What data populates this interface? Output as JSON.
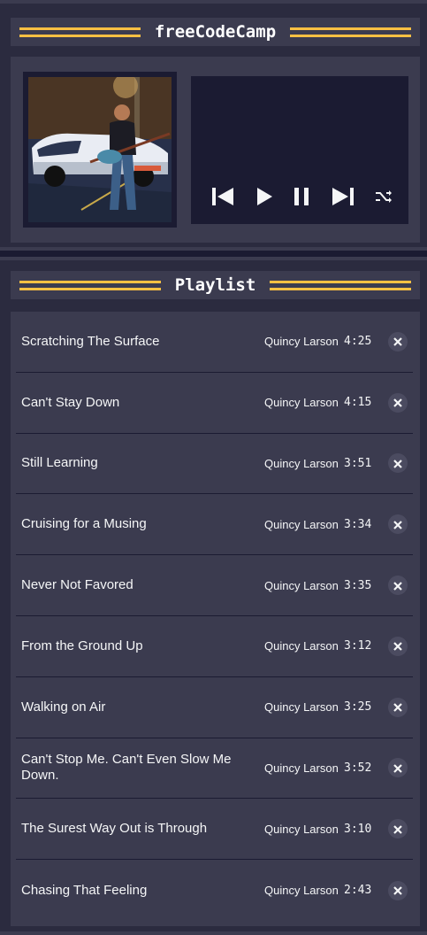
{
  "player": {
    "title": "freeCodeCamp",
    "controls": [
      {
        "name": "previous-button",
        "icon": "previous-icon"
      },
      {
        "name": "play-button",
        "icon": "play-icon"
      },
      {
        "name": "pause-button",
        "icon": "pause-icon"
      },
      {
        "name": "next-button",
        "icon": "next-icon"
      },
      {
        "name": "shuffle-button",
        "icon": "shuffle-icon"
      }
    ]
  },
  "playlist": {
    "title": "Playlist",
    "songs": [
      {
        "title": "Scratching The Surface",
        "artist": "Quincy Larson",
        "duration": "4:25"
      },
      {
        "title": "Can't Stay Down",
        "artist": "Quincy Larson",
        "duration": "4:15"
      },
      {
        "title": "Still Learning",
        "artist": "Quincy Larson",
        "duration": "3:51"
      },
      {
        "title": "Cruising for a Musing",
        "artist": "Quincy Larson",
        "duration": "3:34"
      },
      {
        "title": "Never Not Favored",
        "artist": "Quincy Larson",
        "duration": "3:35"
      },
      {
        "title": "From the Ground Up",
        "artist": "Quincy Larson",
        "duration": "3:12"
      },
      {
        "title": "Walking on Air",
        "artist": "Quincy Larson",
        "duration": "3:25"
      },
      {
        "title": "Can't Stop Me. Can't Even Slow Me Down.",
        "artist": "Quincy Larson",
        "duration": "3:52"
      },
      {
        "title": "The Surest Way Out is Through",
        "artist": "Quincy Larson",
        "duration": "3:10"
      },
      {
        "title": "Chasing That Feeling",
        "artist": "Quincy Larson",
        "duration": "2:43"
      }
    ]
  },
  "colors": {
    "accent": "#fec043",
    "background": "#1b1b32",
    "panel": "#3b3b4f"
  }
}
